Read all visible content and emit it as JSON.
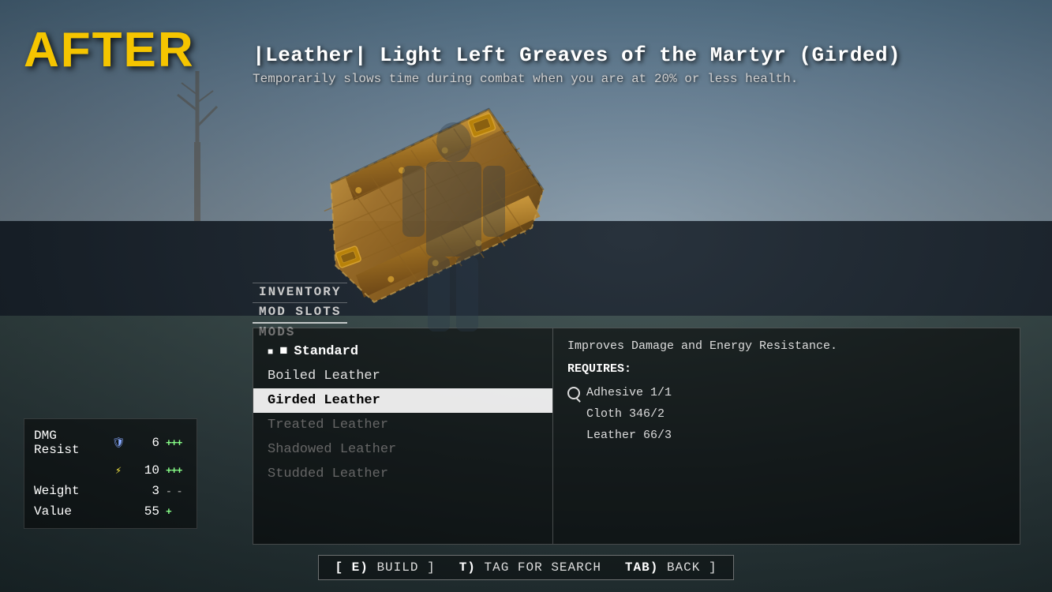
{
  "label": {
    "after": "AFTER"
  },
  "item": {
    "title": "|Leather| Light Left Greaves of the Martyr (Girded)",
    "subtitle": "Temporarily slows time during combat when you are at 20% or less health."
  },
  "tabs": [
    {
      "id": "inventory",
      "label": "INVENTORY",
      "active": false
    },
    {
      "id": "mod-slots",
      "label": "MOD SLOTS",
      "active": false
    },
    {
      "id": "mods",
      "label": "MODS",
      "active": true
    }
  ],
  "mods": {
    "list": [
      {
        "id": "standard",
        "label": "Standard",
        "type": "standard",
        "selected": false
      },
      {
        "id": "boiled",
        "label": "Boiled Leather",
        "type": "normal",
        "selected": false
      },
      {
        "id": "girded",
        "label": "Girded Leather",
        "type": "normal",
        "selected": true
      },
      {
        "id": "treated",
        "label": "Treated Leather",
        "type": "locked",
        "selected": false
      },
      {
        "id": "shadowed",
        "label": "Shadowed Leather",
        "type": "locked",
        "selected": false
      },
      {
        "id": "studded",
        "label": "Studded Leather",
        "type": "locked",
        "selected": false
      }
    ],
    "description": "Improves Damage and Energy Resistance.",
    "requires_label": "REQUIRES:",
    "requirements": [
      {
        "id": "adhesive",
        "icon": "search",
        "text": "Adhesive 1/1"
      },
      {
        "id": "cloth",
        "icon": null,
        "text": "Cloth 346/2"
      },
      {
        "id": "leather",
        "icon": null,
        "text": "Leather 66/3"
      }
    ]
  },
  "stats": {
    "dmg_resist": {
      "label": "DMG Resist",
      "rows": [
        {
          "icon": "shield",
          "value": "6",
          "change": "+++"
        },
        {
          "icon": "bolt",
          "value": "10",
          "change": "+++"
        }
      ]
    },
    "weight": {
      "label": "Weight",
      "value": "3",
      "change": "- -"
    },
    "value": {
      "label": "Value",
      "value": "55",
      "change": "+"
    }
  },
  "actions": [
    {
      "id": "build",
      "key": "E)",
      "label": "BUILD"
    },
    {
      "id": "tag",
      "key": "T)",
      "label": "TAG FOR SEARCH"
    },
    {
      "id": "back",
      "key": "TAB)",
      "label": "BACK"
    }
  ],
  "colors": {
    "accent_yellow": "#f5c500",
    "text_white": "#ffffff",
    "text_gray": "#cccccc",
    "text_muted": "#666666",
    "increase": "#88ff88",
    "selected_bg": "#f0f0f0"
  }
}
